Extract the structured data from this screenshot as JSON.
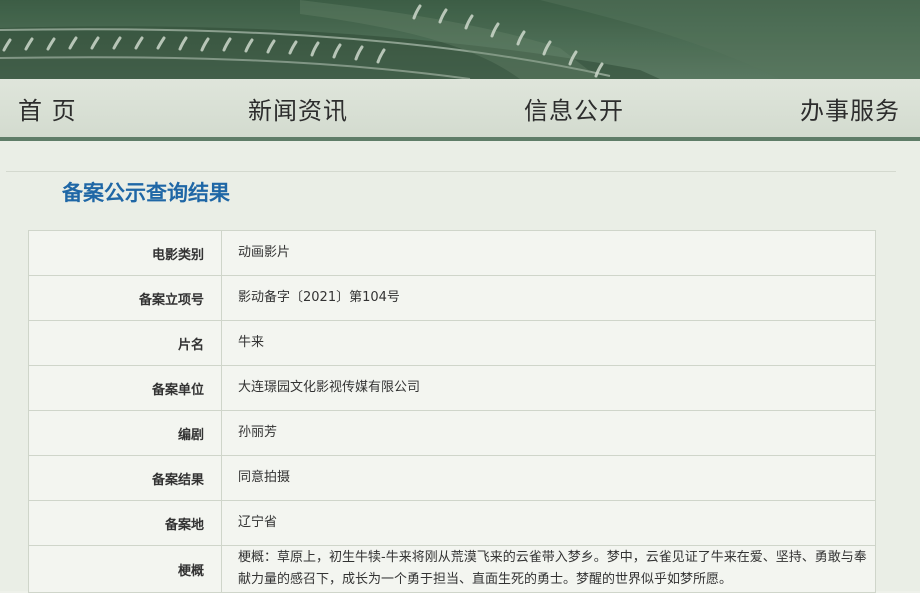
{
  "nav": {
    "items": [
      {
        "id": "home",
        "label": "首 页"
      },
      {
        "id": "news",
        "label": "新闻资讯"
      },
      {
        "id": "info",
        "label": "信息公开"
      },
      {
        "id": "services",
        "label": "办事服务"
      }
    ]
  },
  "page": {
    "title": "备案公示查询结果"
  },
  "record": {
    "rows": [
      {
        "label": "电影类别",
        "value": "动画影片"
      },
      {
        "label": "备案立项号",
        "value": "影动备字〔2021〕第104号"
      },
      {
        "label": "片名",
        "value": "牛来"
      },
      {
        "label": "备案单位",
        "value": "大连璟园文化影视传媒有限公司"
      },
      {
        "label": "编剧",
        "value": "孙丽芳"
      },
      {
        "label": "备案结果",
        "value": "同意拍摄"
      },
      {
        "label": "备案地",
        "value": "辽宁省"
      },
      {
        "label": "梗概",
        "value": "梗概：草原上，初生牛犊-牛来将刚从荒漠飞来的云雀带入梦乡。梦中，云雀见证了牛来在爱、坚持、勇敢与奉献力量的感召下，成长为一个勇于担当、直面生死的勇士。梦醒的世界似乎如梦所愿。"
      }
    ]
  },
  "colors": {
    "banner": "#4f7058",
    "title_blue": "#1f67a6",
    "nav_border": "#5f7d68"
  }
}
